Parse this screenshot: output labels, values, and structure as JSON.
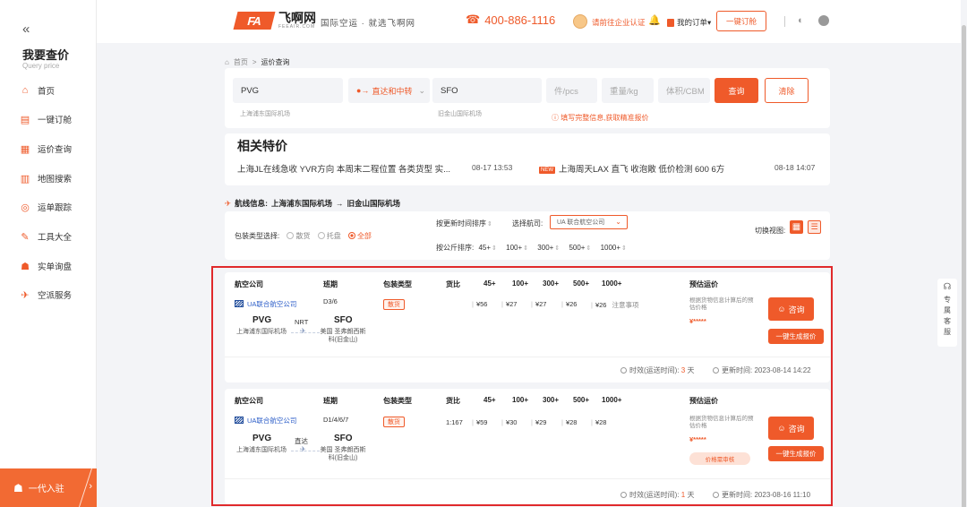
{
  "sidebar": {
    "collapse": "«",
    "title": "我要查价",
    "subtitle": "Query price",
    "items": [
      {
        "label": "首页",
        "icon": "home-icon",
        "glyph": "⌂"
      },
      {
        "label": "一键订舱",
        "icon": "booking-icon",
        "glyph": "▤"
      },
      {
        "label": "运价查询",
        "icon": "price-query-icon",
        "glyph": "▦"
      },
      {
        "label": "地图搜索",
        "icon": "map-search-icon",
        "glyph": "▥"
      },
      {
        "label": "运单跟踪",
        "icon": "tracking-icon",
        "glyph": "◎"
      },
      {
        "label": "工具大全",
        "icon": "tools-icon",
        "glyph": "✎"
      },
      {
        "label": "实单询盘",
        "icon": "inquiry-icon",
        "glyph": "☗"
      },
      {
        "label": "空派服务",
        "icon": "air-service-icon",
        "glyph": "✈"
      }
    ],
    "join_label": "一代入驻",
    "join_arrow": "›"
  },
  "header": {
    "logo_mark": "FA",
    "logo_cn": "飞啊网",
    "logo_en": "FEEAIR.COM",
    "slogan": "国际空运 · 就选飞啊网",
    "phone_icon": "headset-icon",
    "phone": "400-886-1116",
    "cert_link": "请前往企业认证",
    "orders": "我的订单▾",
    "quick_book": "一键订舱",
    "accent": "#ef5a2a"
  },
  "breadcrumb": {
    "home": "首页",
    "sep": ">",
    "current": "运价查询"
  },
  "search": {
    "origin": "PVG",
    "origin_hint": "上海浦东国际机场",
    "route_type": "直达和中转",
    "destination": "SFO",
    "destination_hint": "旧金山国际机场",
    "pieces_placeholder": "件/pcs",
    "weight_placeholder": "重量/kg",
    "volume_placeholder": "体积/CBM",
    "search_label": "查询",
    "clear_label": "清除",
    "warning": "ⓘ 填写完整信息,获取精准报价"
  },
  "specials": {
    "title": "相关特价",
    "items": [
      {
        "text": "上海JL在线急收 YVR方向 本周末二程位置 各类货型 实...",
        "date": "08-17 13:53",
        "badge": ""
      },
      {
        "text": "上海周天LAX 直飞 收泡敞 低价检测 600 6方",
        "date": "08-18 14:07",
        "badge": "NEW"
      }
    ]
  },
  "route_info": {
    "label": "航线信息:",
    "from": "上海浦东国际机场",
    "arrow": "→",
    "to": "旧金山国际机场"
  },
  "filters": {
    "pack_label": "包装类型选择:",
    "pack_options": [
      "散货",
      "托盘",
      "全部"
    ],
    "pack_selected": "全部",
    "sort_update": "按更新时间排序",
    "choose_airline_label": "选择航司:",
    "airline_value": "UA 联合航空公司",
    "sort_weight_label": "按公斤排序:",
    "weight_breaks": [
      "45+",
      "100+",
      "300+",
      "500+",
      "1000+"
    ],
    "view_label": "切换视图:"
  },
  "table_headers": [
    "航空公司",
    "班期",
    "包装类型",
    "货比",
    "45+",
    "100+",
    "300+",
    "500+",
    "1000+",
    "预估运价"
  ],
  "rates": [
    {
      "airline": "UA联合航空公司",
      "schedule": "D3/6",
      "pack": "散货",
      "ratio": "",
      "prices": [
        "¥56",
        "¥27",
        "¥27",
        "¥26",
        "¥26"
      ],
      "extra_note": "注意事项",
      "from_code": "PVG",
      "from_name": "上海浦东国际机场",
      "via": "NRT",
      "to_code": "SFO",
      "to_name": "美国 圣弗朗西斯科(旧金山)",
      "est_note": "根据货物信息计算后的预估价格",
      "est_value": "¥*****",
      "consult": "咨询",
      "generate": "一键生成报价",
      "price_tag": "",
      "aging_label": "时效(运送时间):",
      "aging_value": "3",
      "aging_unit": "天",
      "updated_label": "更新时间:",
      "updated": "2023-08-14 14:22"
    },
    {
      "airline": "UA联合航空公司",
      "schedule": "D1/4/6/7",
      "pack": "散货",
      "ratio": "1:167",
      "prices": [
        "¥59",
        "¥30",
        "¥29",
        "¥28",
        "¥28"
      ],
      "extra_note": "",
      "from_code": "PVG",
      "from_name": "上海浦东国际机场",
      "via": "直达",
      "to_code": "SFO",
      "to_name": "美国 圣弗朗西斯科(旧金山)",
      "est_note": "根据货物信息计算后的预估价格",
      "est_value": "¥*****",
      "consult": "咨询",
      "generate": "一键生成报价",
      "price_tag": "价格需审核",
      "aging_label": "时效(运送时间):",
      "aging_value": "1",
      "aging_unit": "天",
      "updated_label": "更新时间:",
      "updated": "2023-08-16 11:10"
    }
  ],
  "helper": {
    "label": "专属客服"
  }
}
